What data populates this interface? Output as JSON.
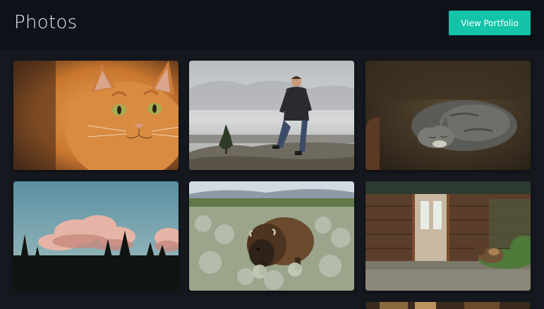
{
  "header": {
    "title": "Photos",
    "portfolio_button_label": "View Portfolio",
    "accent_color": "#13c4a9",
    "background_color": "#0d1118"
  },
  "gallery": {
    "background_color": "#15191f",
    "photos": [
      {
        "subject": "orange kitten close-up"
      },
      {
        "subject": "man standing on rocky cliff"
      },
      {
        "subject": "gray cat sleeping on sofa"
      },
      {
        "subject": "pink clouds over tree silhouettes"
      },
      {
        "subject": "bison in sagebrush field"
      },
      {
        "subject": "cat lying by wooden cabin"
      },
      {
        "subject": "partially visible photo"
      }
    ]
  }
}
